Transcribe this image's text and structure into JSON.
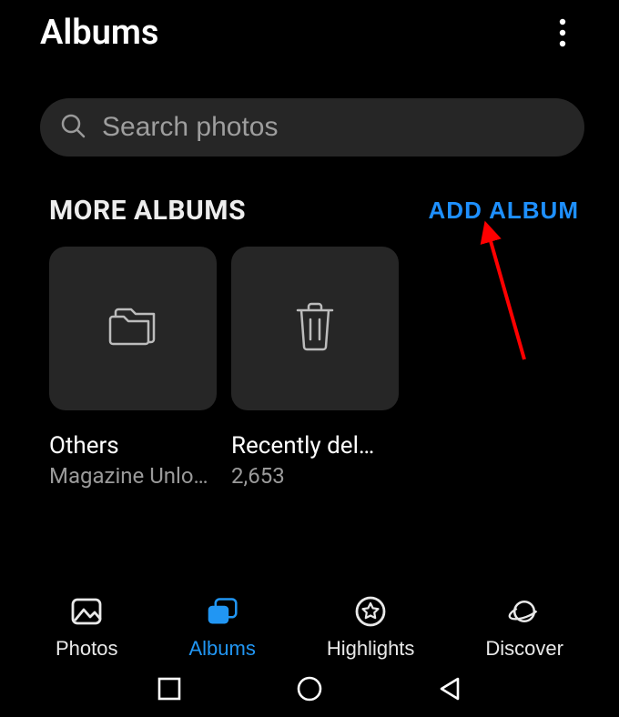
{
  "header": {
    "title": "Albums"
  },
  "search": {
    "placeholder": "Search photos"
  },
  "section": {
    "title": "MORE ALBUMS",
    "add_label": "ADD ALBUM"
  },
  "albums": [
    {
      "name": "Others",
      "subtitle": "Magazine Unlo…",
      "icon": "folder"
    },
    {
      "name": "Recently del…",
      "subtitle": "2,653",
      "icon": "trash"
    }
  ],
  "tabs": [
    {
      "label": "Photos",
      "icon": "image",
      "active": false
    },
    {
      "label": "Albums",
      "icon": "stack",
      "active": true
    },
    {
      "label": "Highlights",
      "icon": "star",
      "active": false
    },
    {
      "label": "Discover",
      "icon": "planet",
      "active": false
    }
  ],
  "colors": {
    "accent": "#1e90ff",
    "tile": "#262626",
    "muted": "#9a9a9a",
    "annotation": "#ff0000"
  }
}
